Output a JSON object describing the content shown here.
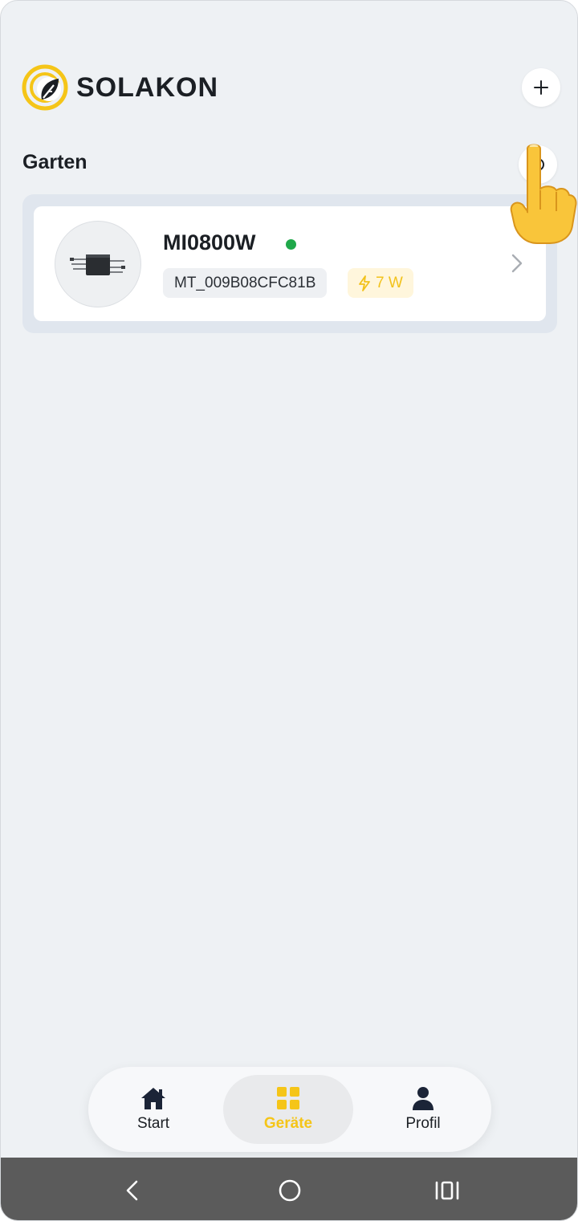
{
  "header": {
    "brand": "SOLAKON",
    "add_icon": "plus-icon",
    "brand_color": "#f5c518"
  },
  "section": {
    "title": "Garten",
    "settings_icon": "gear-icon"
  },
  "device": {
    "name": "MI0800W",
    "status": "online",
    "status_color": "#1fa84a",
    "serial": "MT_009B08CFC81B",
    "power": "7 W",
    "power_icon": "lightning-icon"
  },
  "bottom_nav": {
    "items": [
      {
        "label": "Start",
        "icon": "home-icon",
        "active": false
      },
      {
        "label": "Geräte",
        "icon": "grid-icon",
        "active": true
      },
      {
        "label": "Profil",
        "icon": "person-icon",
        "active": false
      }
    ],
    "active_color": "#f5c518"
  },
  "system_bar": {
    "buttons": [
      "back-icon",
      "home-circle-icon",
      "recent-apps-icon"
    ]
  }
}
